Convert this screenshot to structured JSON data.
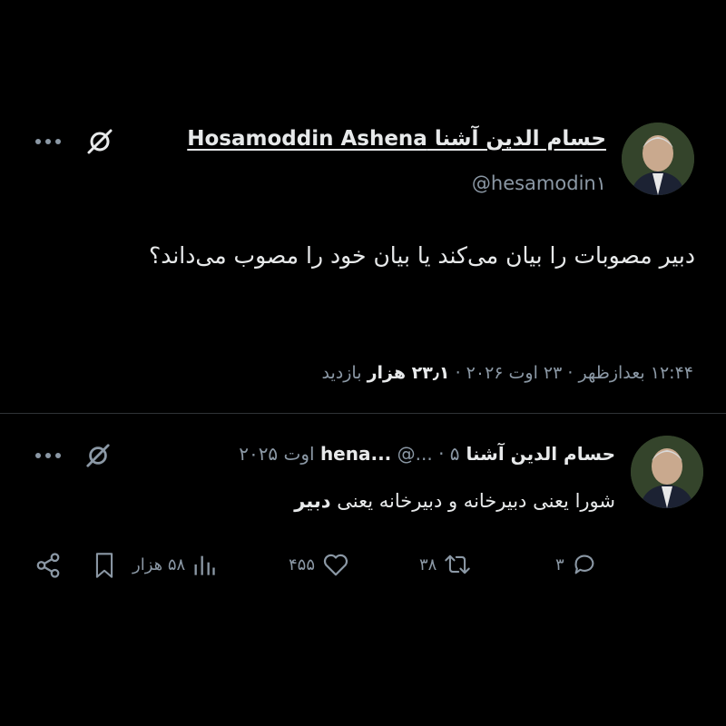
{
  "main_tweet": {
    "display_name": "حسام الدين آشنا Hosamoddin Ashena",
    "handle": "@hesamodin۱",
    "text": "دبیر مصوبات را بیان می‌کند یا بیان خود را مصوب می‌داند؟",
    "time": "۱۲:۴۴ بعدازظهر",
    "date": "۲۳ اوت ۲۰۲۶",
    "views_count": "۲۳٫۱ هزار",
    "views_label": "بازدید",
    "separator": "·",
    "icons": [
      "avatar",
      "grok-icon",
      "more-icon"
    ]
  },
  "quoted_reply": {
    "display_name": "حسام الدين آشنا hena...",
    "handle": "@...",
    "date": "۵ اوت ۲۰۲۵",
    "separator": "·",
    "text_prefix": "شورا یعنی دبیرخانه و دبیرخانه یعنی ",
    "text_bold": "دبیر",
    "replies": "۳",
    "retweets": "۳۸",
    "likes": "۴۵۵",
    "views": "۵۸ هزار",
    "icons": [
      "reply-icon",
      "retweet-icon",
      "like-icon",
      "views-icon",
      "bookmark-icon",
      "share-icon"
    ]
  },
  "colors": {
    "background": "#000000",
    "text": "#e7e9ea",
    "muted": "#8b98a5",
    "divider": "#2f3336"
  }
}
